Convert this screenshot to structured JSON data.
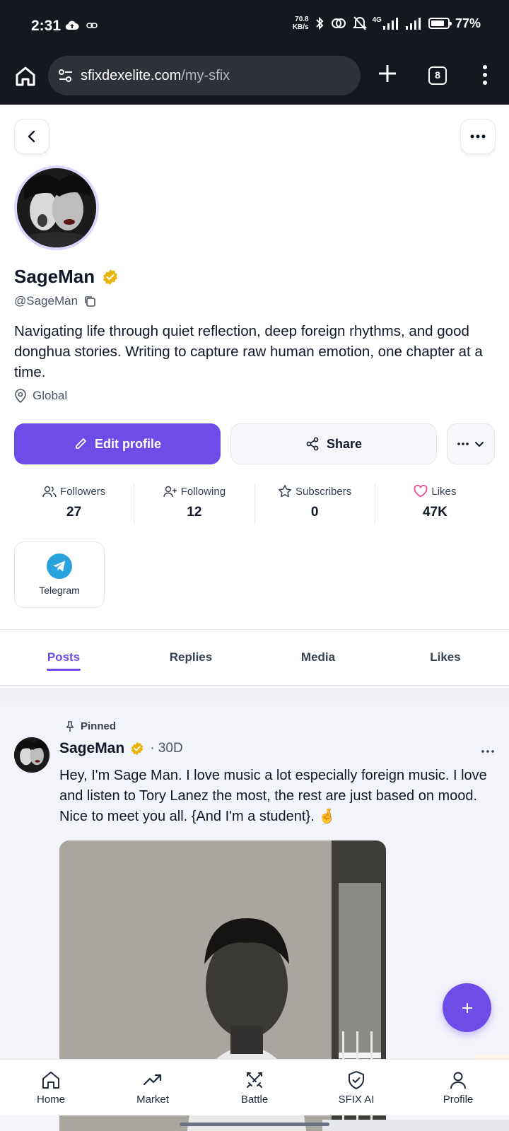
{
  "status_bar": {
    "time": "2:31",
    "speed_value": "70.8",
    "speed_unit": "KB/s",
    "network": "4G",
    "battery": "77%"
  },
  "browser": {
    "domain": "sfixdexelite.com",
    "path": "/my-sfix",
    "tab_count": "8"
  },
  "profile": {
    "name": "SageMan",
    "handle": "@SageMan",
    "bio": "Navigating life through quiet reflection, deep foreign rhythms, and good donghua stories. Writing to capture raw human emotion, one chapter at a time.",
    "location": "Global",
    "verified_color": "#eab308"
  },
  "actions": {
    "edit_label": "Edit profile",
    "share_label": "Share"
  },
  "stats": [
    {
      "label": "Followers",
      "value": "27",
      "icon": "users-icon"
    },
    {
      "label": "Following",
      "value": "12",
      "icon": "user-plus-icon"
    },
    {
      "label": "Subscribers",
      "value": "0",
      "icon": "star-icon"
    },
    {
      "label": "Likes",
      "value": "47K",
      "icon": "heart-icon"
    }
  ],
  "socials": [
    {
      "label": "Telegram",
      "icon": "telegram-icon"
    }
  ],
  "tabs": [
    {
      "label": "Posts",
      "active": true
    },
    {
      "label": "Replies",
      "active": false
    },
    {
      "label": "Media",
      "active": false
    },
    {
      "label": "Likes",
      "active": false
    }
  ],
  "post": {
    "pinned_label": "Pinned",
    "author": "SageMan",
    "age": "· 30D",
    "text": "Hey, I'm Sage Man. I love music a lot especially foreign music. I love and listen to Tory Lanez the most, the rest are just based on mood. Nice to meet you all. {And I'm a student}. 🤞"
  },
  "bottom_nav": [
    {
      "label": "Home",
      "icon": "home-icon"
    },
    {
      "label": "Market",
      "icon": "trending-up-icon"
    },
    {
      "label": "Battle",
      "icon": "swords-icon"
    },
    {
      "label": "SFIX AI",
      "icon": "shield-check-icon"
    },
    {
      "label": "Profile",
      "icon": "user-icon"
    }
  ],
  "colors": {
    "accent": "#6d4ce8",
    "likes_heart": "#ec4899",
    "telegram": "#2aa3dd"
  }
}
